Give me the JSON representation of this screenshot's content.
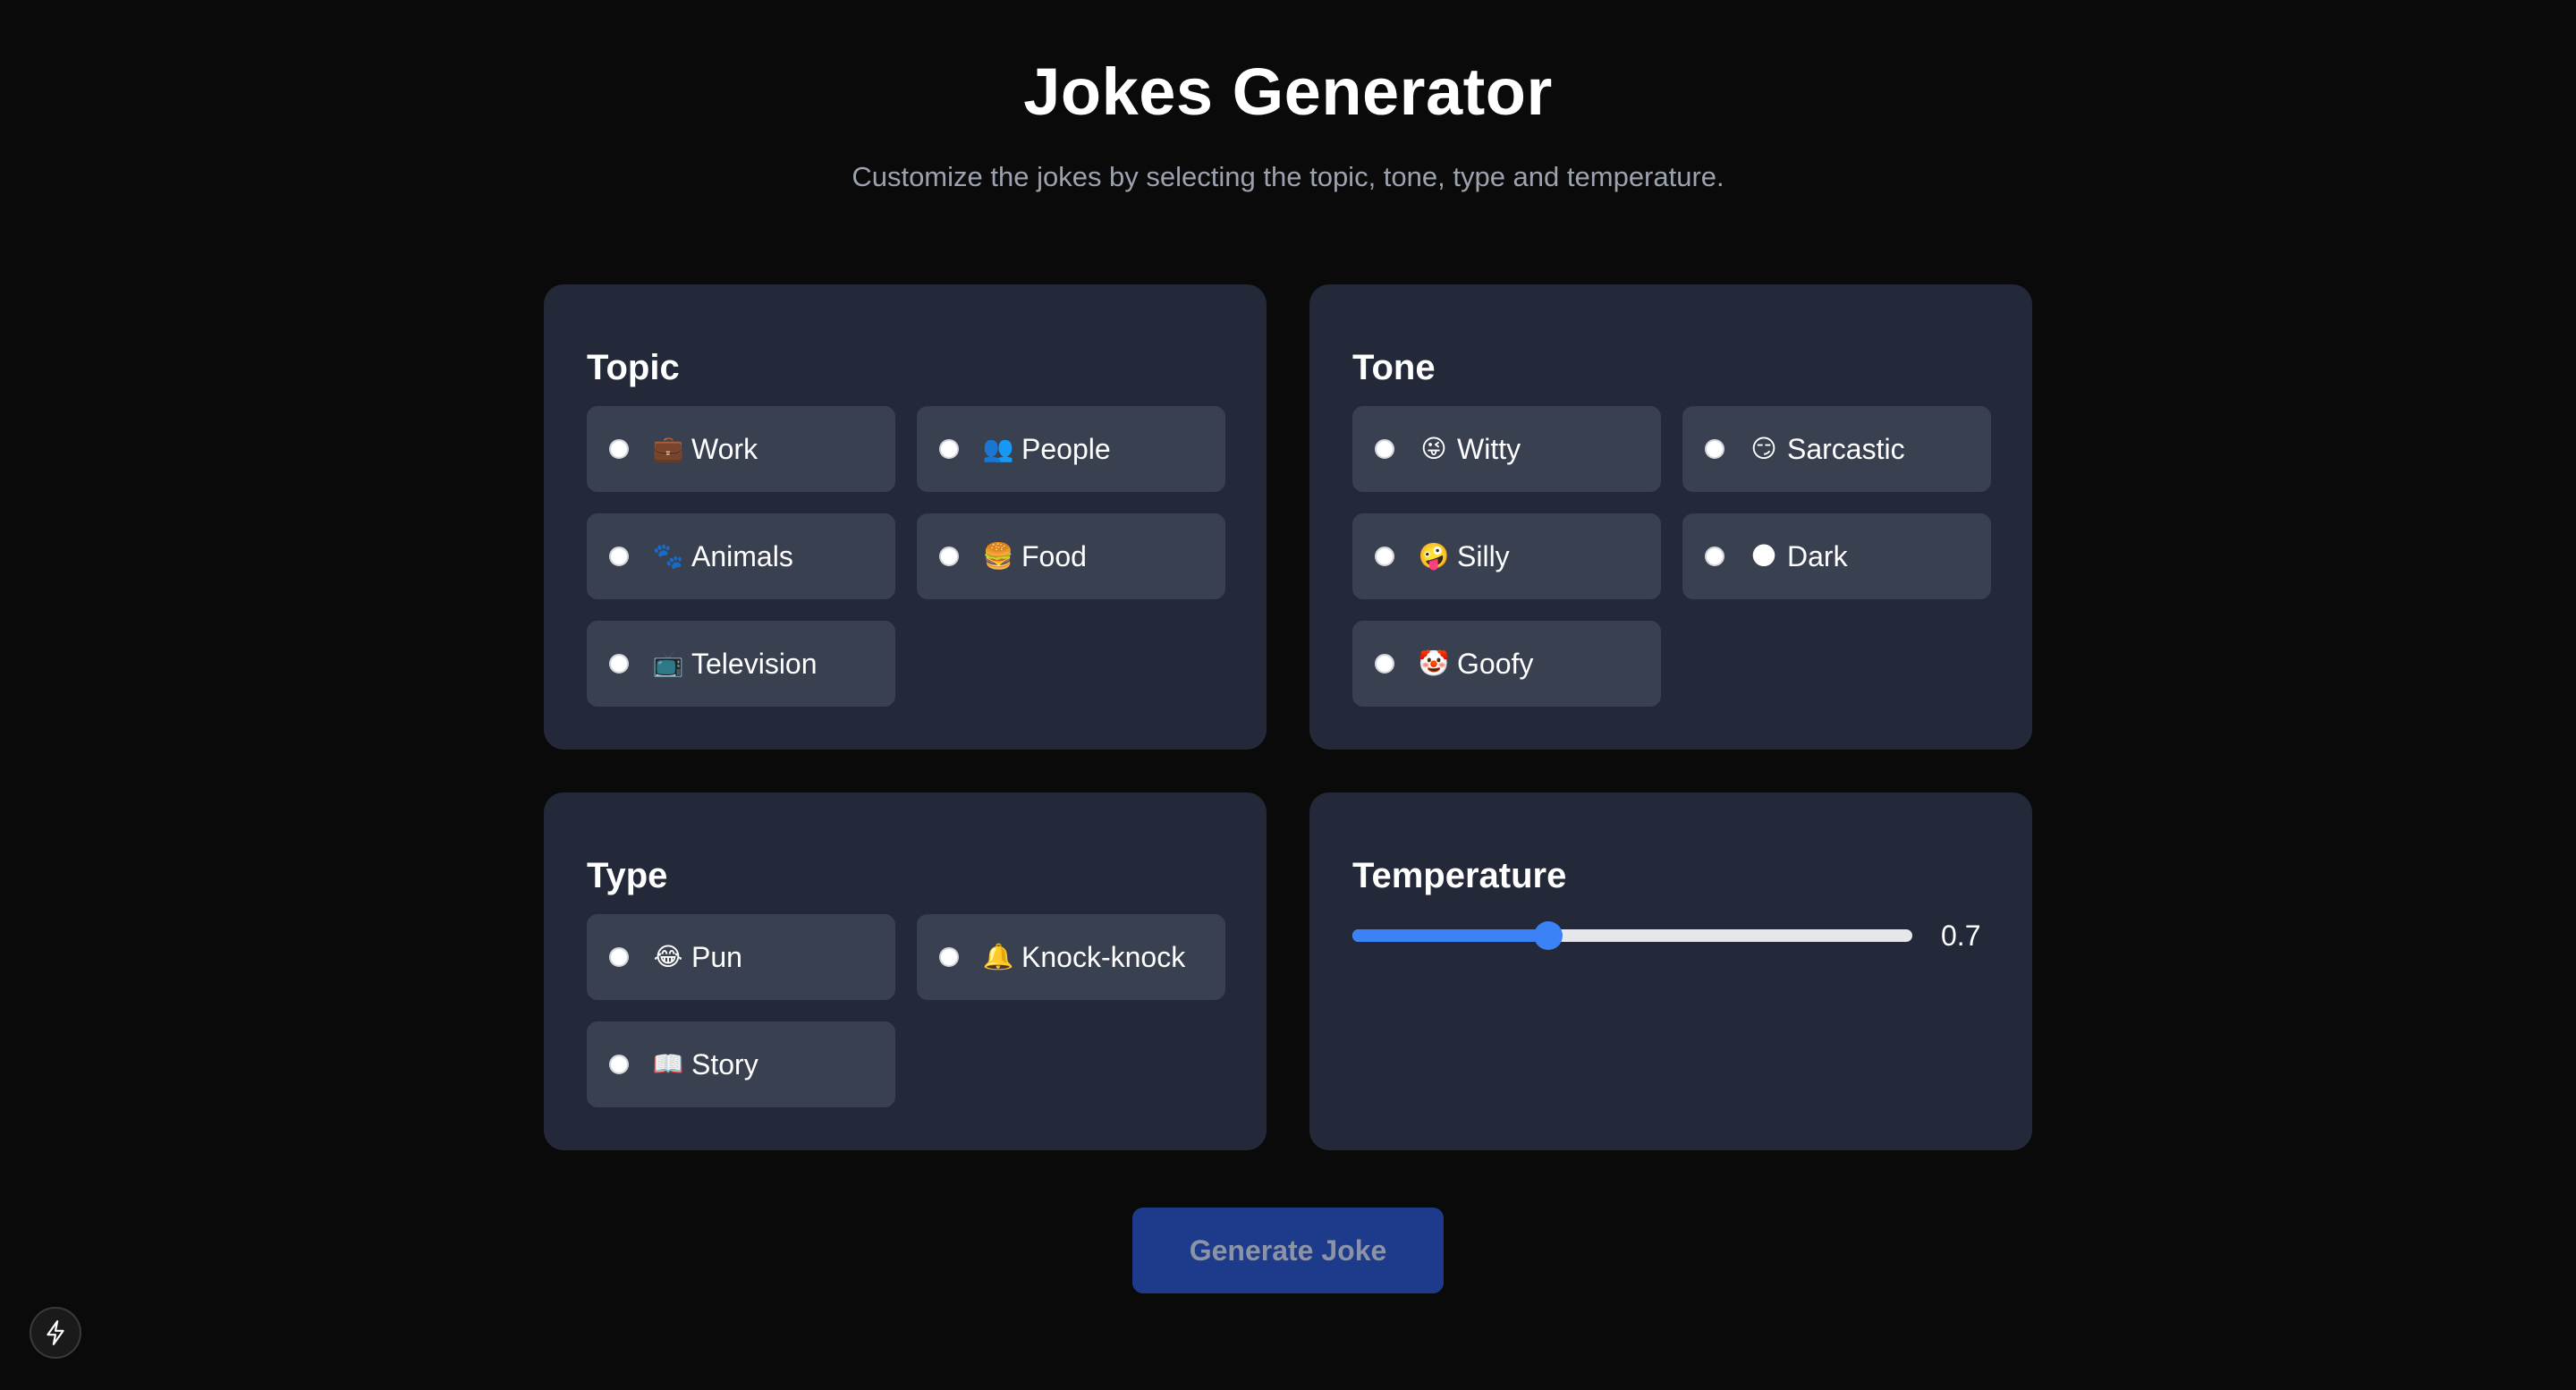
{
  "header": {
    "title": "Jokes Generator",
    "subtitle": "Customize the jokes by selecting the topic, tone, type and temperature."
  },
  "topic": {
    "title": "Topic",
    "options": [
      {
        "emoji": "💼",
        "label": "Work"
      },
      {
        "emoji": "👥",
        "label": "People"
      },
      {
        "emoji": "🐾",
        "label": "Animals"
      },
      {
        "emoji": "🍔",
        "label": "Food"
      },
      {
        "emoji": "📺",
        "label": "Television"
      }
    ]
  },
  "tone": {
    "title": "Tone",
    "options": [
      {
        "emoji": "😜",
        "label": "Witty"
      },
      {
        "emoji": "😏",
        "label": "Sarcastic"
      },
      {
        "emoji": "🤪",
        "label": "Silly"
      },
      {
        "emoji": "🌑",
        "label": "Dark"
      },
      {
        "emoji": "🤡",
        "label": "Goofy"
      }
    ]
  },
  "type": {
    "title": "Type",
    "options": [
      {
        "emoji": "😂",
        "label": "Pun"
      },
      {
        "emoji": "🔔",
        "label": "Knock-knock"
      },
      {
        "emoji": "📖",
        "label": "Story"
      }
    ]
  },
  "temperature": {
    "title": "Temperature",
    "value": "0.7",
    "fraction": 0.35
  },
  "generate_button": {
    "label": "Generate Joke"
  },
  "icons": {
    "devtools": "lightning-bolt-icon"
  },
  "colors": {
    "background": "#0a0a0a",
    "card": "#232938",
    "option": "#394050",
    "accent": "#3b82f6",
    "button": "#1e3a8a"
  }
}
